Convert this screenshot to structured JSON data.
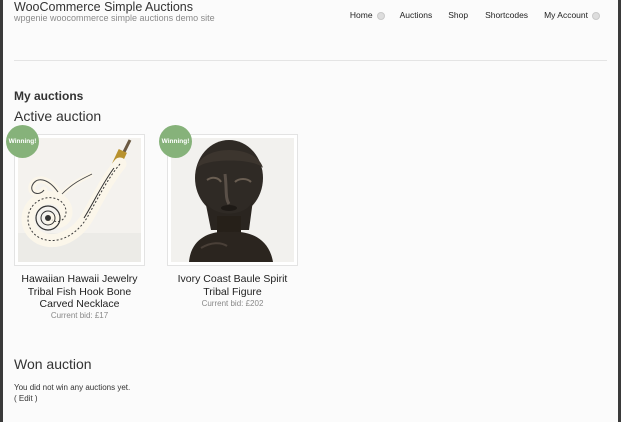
{
  "site": {
    "title": "WooCommerce Simple Auctions",
    "tagline": "wpgenie woocommerce simple auctions demo site"
  },
  "nav": {
    "items": [
      {
        "label": "Home",
        "has_submenu": true
      },
      {
        "label": "Auctions",
        "has_submenu": false
      },
      {
        "label": "Shop",
        "has_submenu": false
      },
      {
        "label": "Shortcodes",
        "has_submenu": false
      },
      {
        "label": "My Account",
        "has_submenu": true
      }
    ]
  },
  "page": {
    "heading": "My auctions",
    "active_heading": "Active auction",
    "won_heading": "Won auction",
    "no_won_text": "You did not win any auctions yet.",
    "edit_label": "( Edit )"
  },
  "products": [
    {
      "badge": "Winning!",
      "name_lines": [
        "Hawaiian Hawaii Jewelry",
        "Tribal Fish Hook Bone",
        "Carved Necklace"
      ],
      "bid": "Current bid: £17",
      "image": "fish-hook-necklace-photo"
    },
    {
      "badge": "Winning!",
      "name_lines": [
        "Ivory Coast Baule Spirit",
        "Tribal Figure"
      ],
      "bid": "Current bid: £202",
      "image": "tribal-figure-photo"
    }
  ],
  "colors": {
    "badge": "#86b27a",
    "background": "#fbfbfb",
    "text": "#333333"
  }
}
